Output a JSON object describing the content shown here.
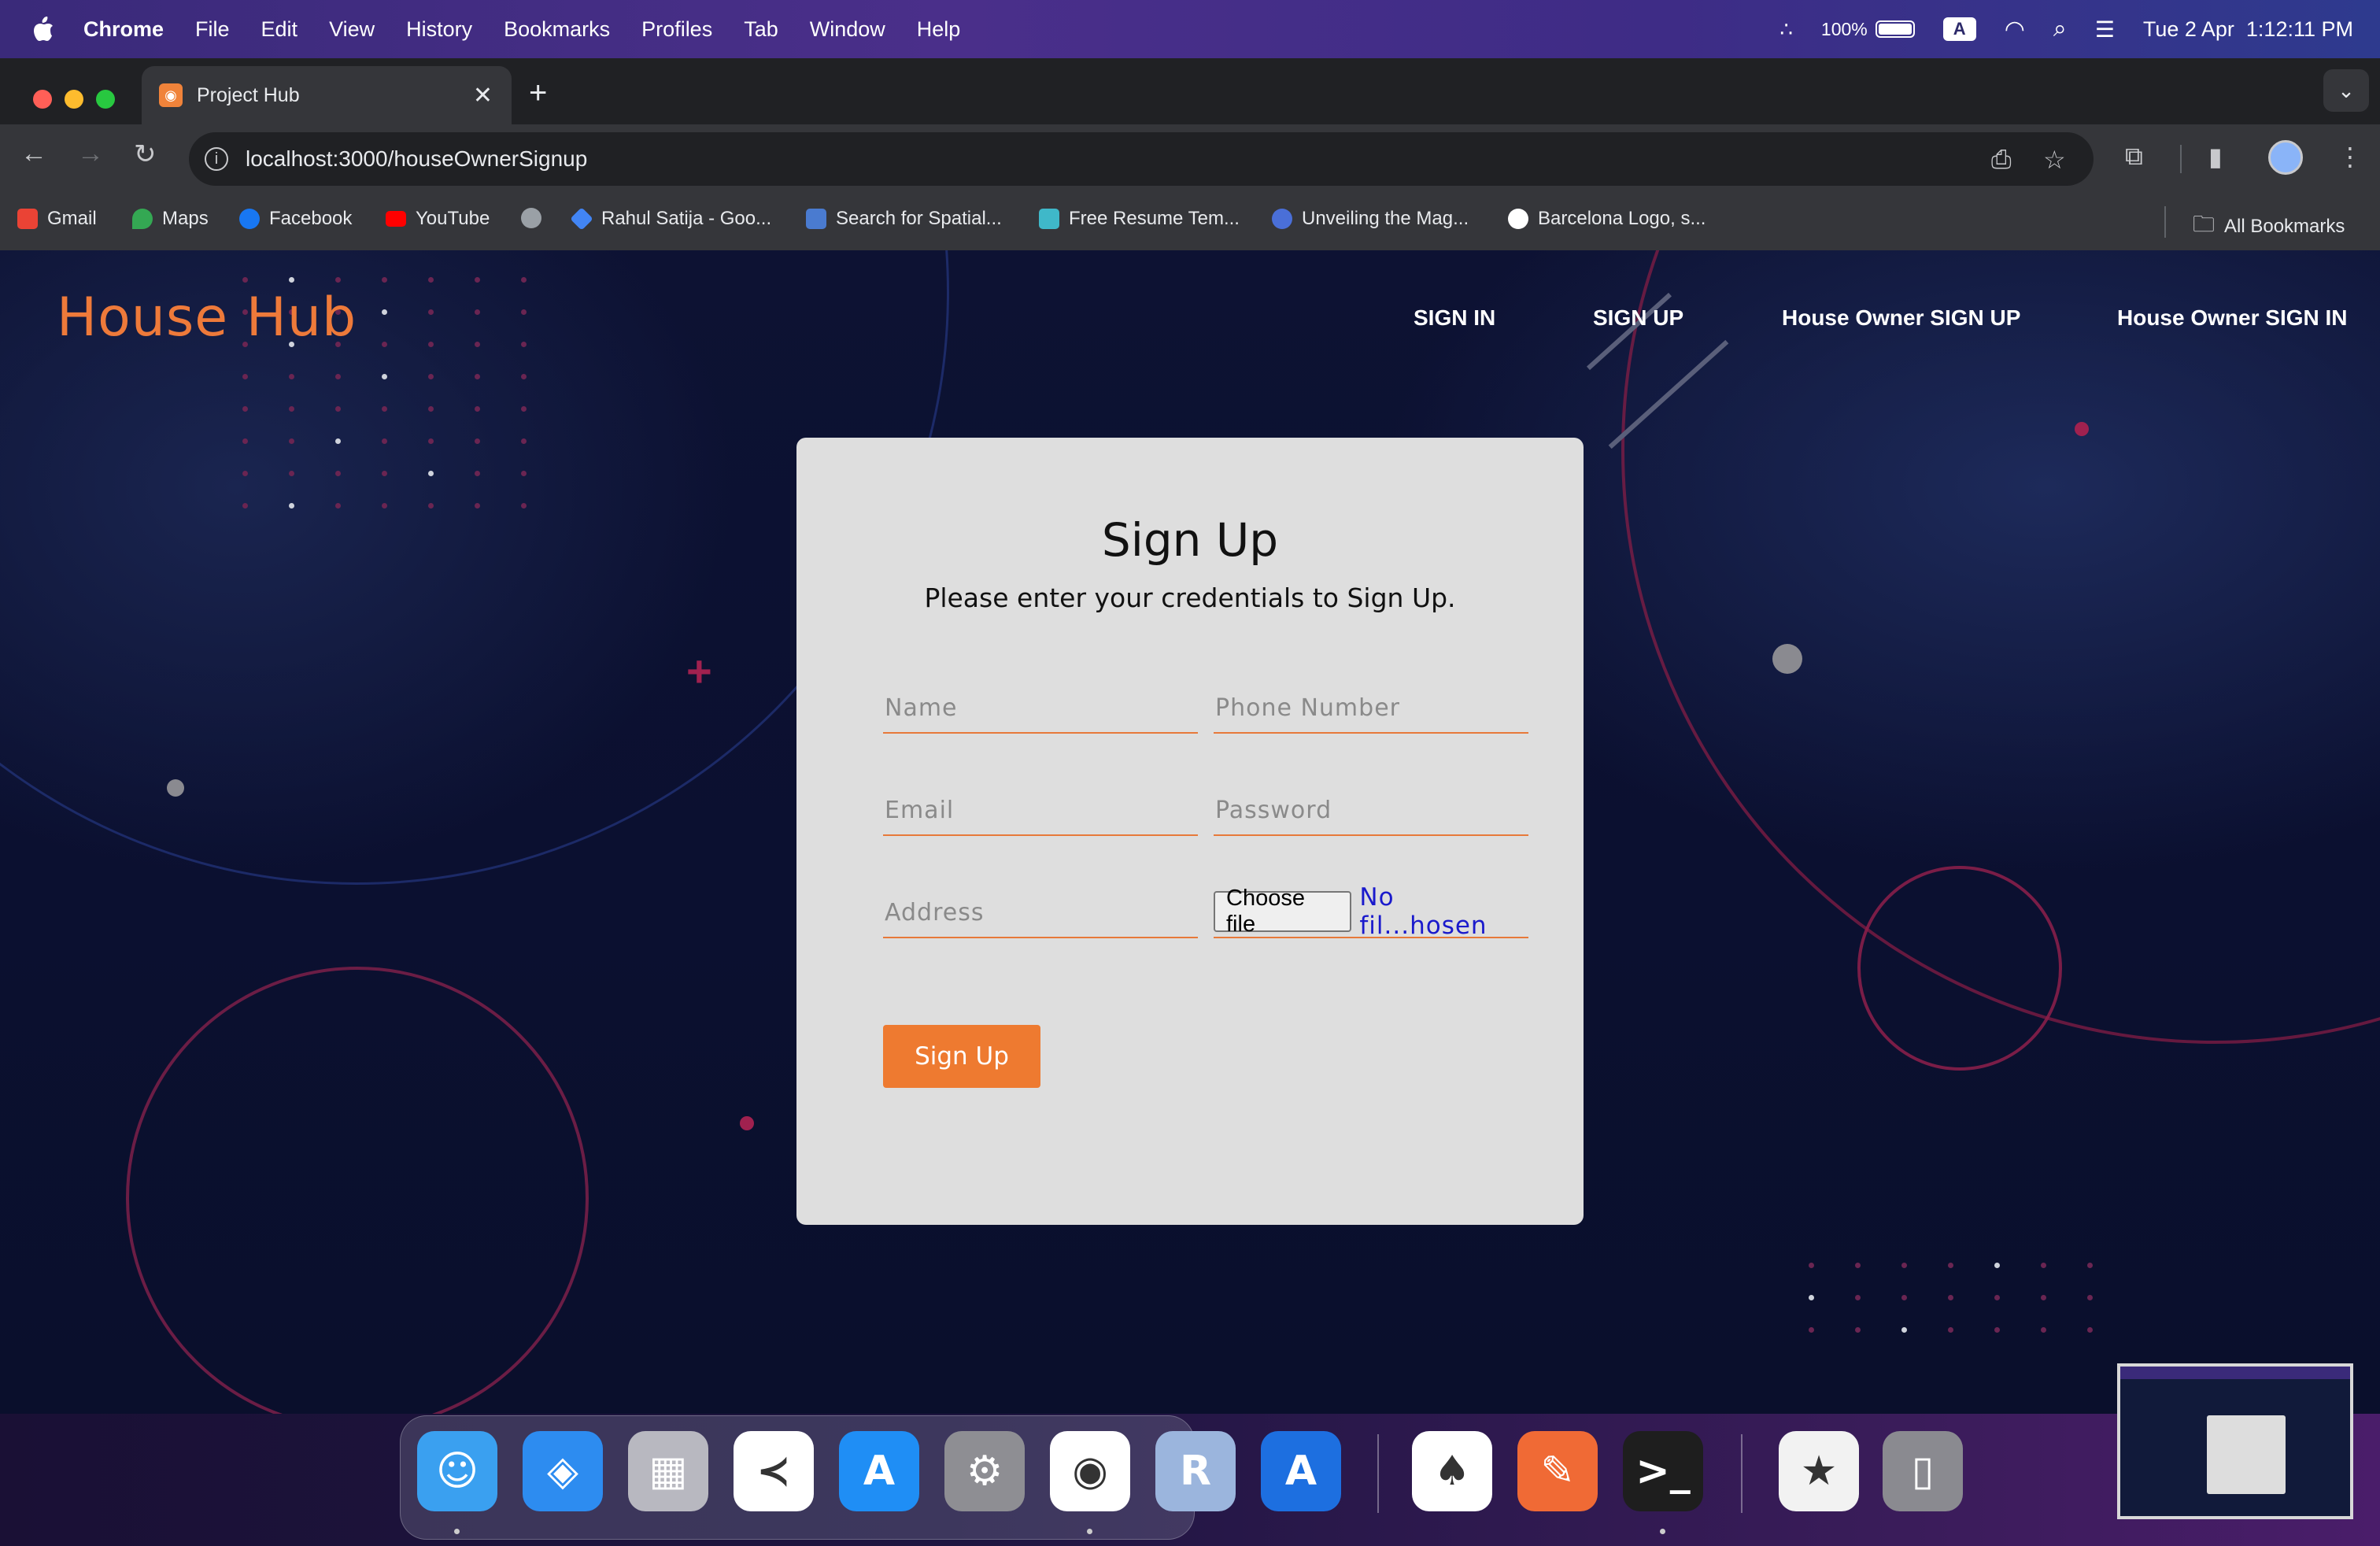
{
  "menubar": {
    "app_name": "Chrome",
    "items": [
      "File",
      "Edit",
      "View",
      "History",
      "Bookmarks",
      "Profiles",
      "Tab",
      "Window",
      "Help"
    ],
    "battery": "100%",
    "battery_level": 1.0,
    "input_source": "A",
    "datetime": "Tue 2 Apr  1:12:11 PM"
  },
  "browser": {
    "tab_title": "Project Hub",
    "url": "localhost:3000/houseOwnerSignup",
    "bookmarks": [
      {
        "label": "Gmail",
        "icon": "gmail-icon",
        "color": "#ea4335"
      },
      {
        "label": "Maps",
        "icon": "maps-icon",
        "color": "#34a853"
      },
      {
        "label": "Facebook",
        "icon": "facebook-icon",
        "color": "#1877f2"
      },
      {
        "label": "YouTube",
        "icon": "youtube-icon",
        "color": "#ff0000"
      },
      {
        "label": "",
        "icon": "globe-icon",
        "color": "#9aa0a6"
      },
      {
        "label": "Rahul Satija - Goo...",
        "icon": "scholar-icon",
        "color": "#4285f4"
      },
      {
        "label": "Search for Spatial...",
        "icon": "spatial-icon",
        "color": "#4a7bd0"
      },
      {
        "label": "Free Resume Tem...",
        "icon": "resume-icon",
        "color": "#3fb8c9"
      },
      {
        "label": "Unveiling the Mag...",
        "icon": "article-icon",
        "color": "#4a6fd8"
      },
      {
        "label": "Barcelona Logo, s...",
        "icon": "google-icon",
        "color": "#ffffff"
      }
    ],
    "all_bookmarks": "All Bookmarks"
  },
  "site": {
    "brand": "House Hub",
    "brand_color": "#ee7a3a",
    "nav": [
      "SIGN IN",
      "SIGN UP",
      "House Owner SIGN UP",
      "House Owner SIGN IN"
    ]
  },
  "form": {
    "title": "Sign Up",
    "subtitle": "Please enter your credentials to Sign Up.",
    "name_placeholder": "Name",
    "phone_placeholder": "Phone Number",
    "email_placeholder": "Email",
    "password_placeholder": "Password",
    "address_placeholder": "Address",
    "file_button": "Choose file",
    "file_status": "No fil...hosen",
    "submit_label": "Sign Up",
    "accent_color": "#ee7a30"
  },
  "dock": {
    "apps": [
      {
        "name": "Finder",
        "icon": "finder-icon",
        "color": "#3aa0f0",
        "glyph": "☺"
      },
      {
        "name": "Safari",
        "icon": "safari-icon",
        "color": "#2d8cf0",
        "glyph": "◈"
      },
      {
        "name": "Launchpad",
        "icon": "launchpad-icon",
        "color": "#b8b8c0",
        "glyph": "▦"
      },
      {
        "name": "Visual Studio Code",
        "icon": "vscode-icon",
        "color": "#ffffff",
        "glyph": "≺"
      },
      {
        "name": "App Store",
        "icon": "appstore-icon",
        "color": "#1f8ef5",
        "glyph": "A"
      },
      {
        "name": "System Settings",
        "icon": "settings-icon",
        "color": "#8e8e93",
        "glyph": "⚙"
      },
      {
        "name": "Google Chrome",
        "icon": "chrome-icon",
        "color": "#ffffff",
        "glyph": "◉"
      },
      {
        "name": "R",
        "icon": "r-icon",
        "color": "#9bb5dd",
        "glyph": "R"
      },
      {
        "name": "Xcode",
        "icon": "xcode-icon",
        "color": "#1d6fe0",
        "glyph": "A"
      },
      {
        "name": "MongoDB Compass",
        "icon": "mongodb-icon",
        "color": "#ffffff",
        "glyph": "♠"
      },
      {
        "name": "Postman",
        "icon": "postman-icon",
        "color": "#f06a35",
        "glyph": "✎"
      },
      {
        "name": "Terminal",
        "icon": "terminal-icon",
        "color": "#1e1e1e",
        "glyph": ">_"
      },
      {
        "name": "Document",
        "icon": "document-icon",
        "color": "#f2f2f2",
        "glyph": "★"
      },
      {
        "name": "Trash",
        "icon": "trash-icon",
        "color": "#8a8a90",
        "glyph": "▯"
      }
    ]
  }
}
